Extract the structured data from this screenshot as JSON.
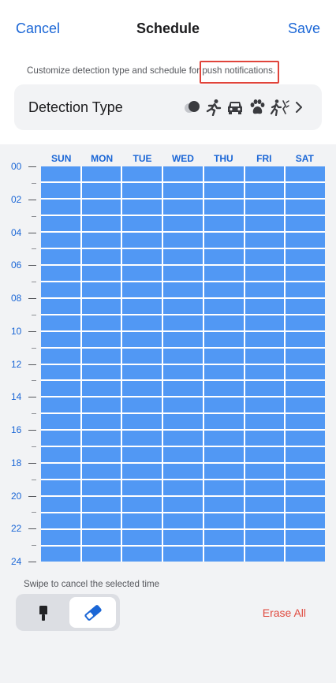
{
  "header": {
    "cancel_label": "Cancel",
    "title": "Schedule",
    "save_label": "Save"
  },
  "description": {
    "text": "Customize detection type and schedule for ",
    "highlight": "push notifications."
  },
  "detection": {
    "label": "Detection Type",
    "icons": [
      "all-objects-icon",
      "person-running-icon",
      "vehicle-icon",
      "pet-paw-icon",
      "person-crossing-line-icon",
      "chevron-right-icon"
    ]
  },
  "days": [
    "SUN",
    "MON",
    "TUE",
    "WED",
    "THU",
    "FRI",
    "SAT"
  ],
  "hour_labels": [
    "00",
    "02",
    "04",
    "06",
    "08",
    "10",
    "12",
    "14",
    "16",
    "18",
    "20",
    "22",
    "24"
  ],
  "schedule": {
    "slots_per_day": 24,
    "all_selected": true
  },
  "footer": {
    "hint": "Swipe to cancel the selected time",
    "erase_all_label": "Erase All",
    "selected_tool": "eraser"
  },
  "colors": {
    "accent": "#1a66d6",
    "selected_cell": "#5198f4",
    "danger": "#e04a3f",
    "highlight_box": "#e0443b"
  }
}
